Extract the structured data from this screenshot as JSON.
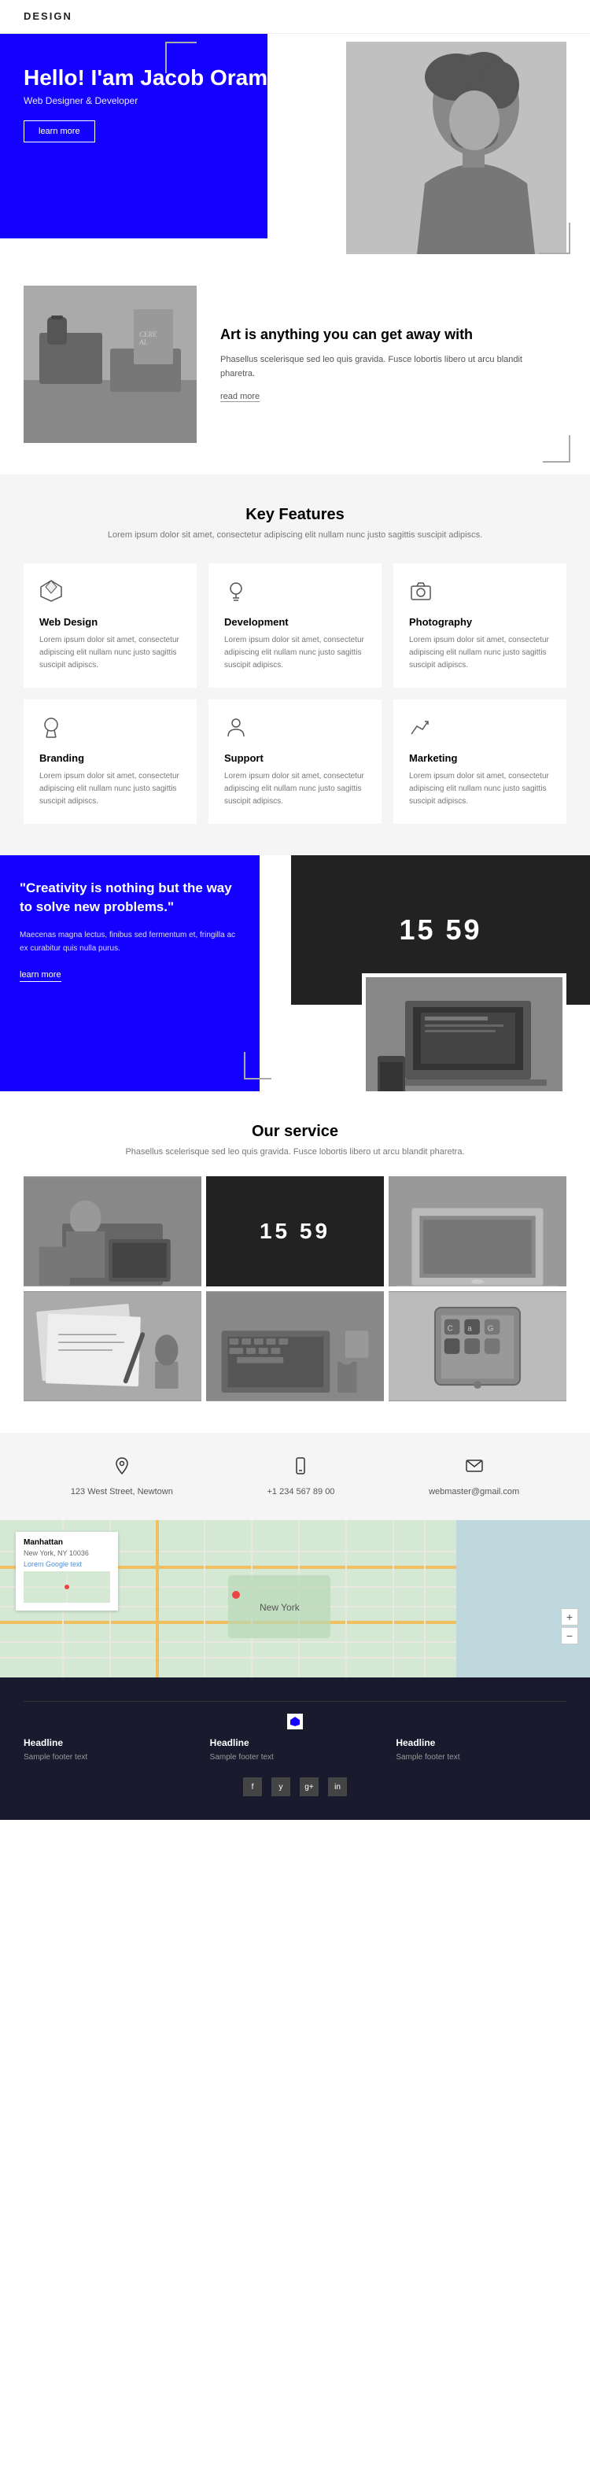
{
  "header": {
    "title": "DESIGN"
  },
  "hero": {
    "greeting": "Hello! I'am Jacob Oram",
    "subtitle": "Web Designer & Developer",
    "btn_label": "learn more"
  },
  "art": {
    "title": "Art is anything you can get away with",
    "description": "Phasellus scelerisque sed leo quis gravida. Fusce lobortis libero ut arcu blandit pharetra.",
    "read_more": "read more"
  },
  "features": {
    "title": "Key Features",
    "subtitle": "Lorem ipsum dolor sit amet, consectetur adipiscing elit nullam nunc justo sagittis suscipit adipiscs.",
    "items": [
      {
        "name": "Web Design",
        "icon": "diamond",
        "description": "Lorem ipsum dolor sit amet, consectetur adipiscing elit nullam nunc justo sagittis suscipit adipiscs."
      },
      {
        "name": "Development",
        "icon": "bulb",
        "description": "Lorem ipsum dolor sit amet, consectetur adipiscing elit nullam nunc justo sagittis suscipit adipiscs."
      },
      {
        "name": "Photography",
        "icon": "camera",
        "description": "Lorem ipsum dolor sit amet, consectetur adipiscing elit nullam nunc justo sagittis suscipit adipiscs."
      },
      {
        "name": "Branding",
        "icon": "award",
        "description": "Lorem ipsum dolor sit amet, consectetur adipiscing elit nullam nunc justo sagittis suscipit adipiscs."
      },
      {
        "name": "Support",
        "icon": "person",
        "description": "Lorem ipsum dolor sit amet, consectetur adipiscing elit nullam nunc justo sagittis suscipit adipiscs."
      },
      {
        "name": "Marketing",
        "icon": "chart",
        "description": "Lorem ipsum dolor sit amet, consectetur adipiscing elit nullam nunc justo sagittis suscipit adipiscs."
      }
    ]
  },
  "quote": {
    "text": "\"Creativity is nothing but the way to solve new problems.\"",
    "description": "Maecenas magna lectus, finibus sed fermentum et, fringilla ac ex curabitur quis nulla purus.",
    "btn_label": "learn more",
    "clock_text": "15 59"
  },
  "service": {
    "title": "Our service",
    "subtitle": "Phasellus scelerisque sed leo quis gravida. Fusce lobortis libero ut arcu blandit pharetra."
  },
  "contact": {
    "address": "123 West Street, Newtown",
    "phone": "+1 234 567 89 00",
    "email": "webmaster@gmail.com"
  },
  "map": {
    "overlay_title": "Manhattan",
    "overlay_address": "New York, NY 10036",
    "overlay_subtext": "Lorem Google text"
  },
  "footer": {
    "columns": [
      {
        "title": "Headline",
        "text": "Sample footer text"
      },
      {
        "title": "Headline",
        "text": "Sample footer text"
      },
      {
        "title": "Headline",
        "text": "Sample footer text"
      }
    ],
    "social": [
      "f",
      "y",
      "g+",
      "in"
    ]
  }
}
